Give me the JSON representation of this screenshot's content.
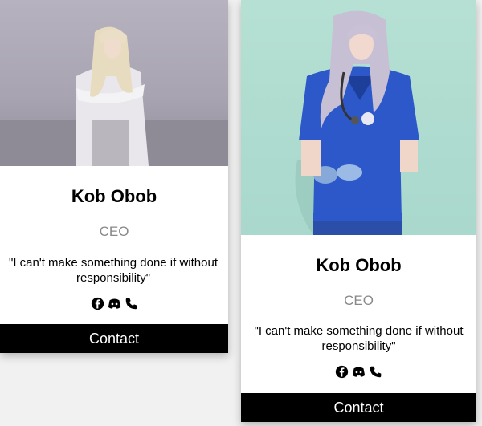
{
  "cards": [
    {
      "name": "Kob Obob",
      "title": "CEO",
      "quote": "\"I can't make something done if without responsibility\"",
      "contact_label": "Contact",
      "socials": [
        "facebook-icon",
        "discord-icon",
        "phone-icon"
      ]
    },
    {
      "name": "Kob Obob",
      "title": "CEO",
      "quote": "\"I can't make something done if without responsibility\"",
      "contact_label": "Contact",
      "socials": [
        "facebook-icon",
        "discord-icon",
        "phone-icon"
      ]
    }
  ],
  "colors": {
    "page_background": "#f1f1f1",
    "card_background": "#ffffff",
    "button_background": "#000000",
    "button_text": "#ffffff",
    "title_text": "#888888",
    "photo1_background": "#b1acb9",
    "photo2_background": "#b0dccf"
  }
}
